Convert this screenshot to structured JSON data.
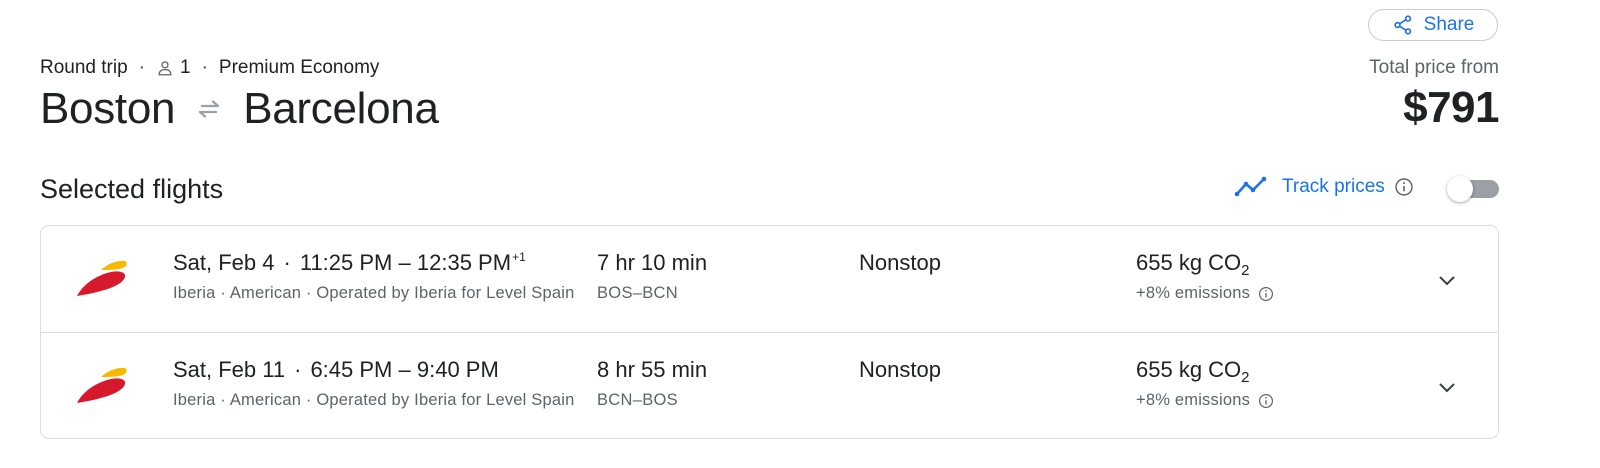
{
  "share_label": "Share",
  "trip": {
    "type": "Round trip",
    "passengers": "1",
    "cabin": "Premium Economy",
    "origin": "Boston",
    "destination": "Barcelona"
  },
  "price": {
    "label": "Total price from",
    "value": "$791"
  },
  "section_title": "Selected flights",
  "track_prices": {
    "label": "Track prices",
    "enabled": false
  },
  "flights": [
    {
      "date": "Sat, Feb 4",
      "depart": "11:25 PM",
      "dash": "–",
      "arrive": "12:35 PM",
      "day_offset": "+1",
      "airlines": "Iberia · American · Operated by Iberia for Level Spain",
      "duration": "7 hr 10 min",
      "airports": "BOS–BCN",
      "stops": "Nonstop",
      "co2_value": "655 kg CO",
      "co2_sub": "2",
      "emissions": "+8% emissions"
    },
    {
      "date": "Sat, Feb 11",
      "depart": "6:45 PM",
      "dash": "–",
      "arrive": "9:40 PM",
      "day_offset": "",
      "airlines": "Iberia · American · Operated by Iberia for Level Spain",
      "duration": "8 hr 55 min",
      "airports": "BCN–BOS",
      "stops": "Nonstop",
      "co2_value": "655 kg CO",
      "co2_sub": "2",
      "emissions": "+8% emissions"
    }
  ],
  "colors": {
    "accent": "#1a73e8",
    "iberia_red": "#d7192d",
    "iberia_yellow": "#f8b800"
  }
}
